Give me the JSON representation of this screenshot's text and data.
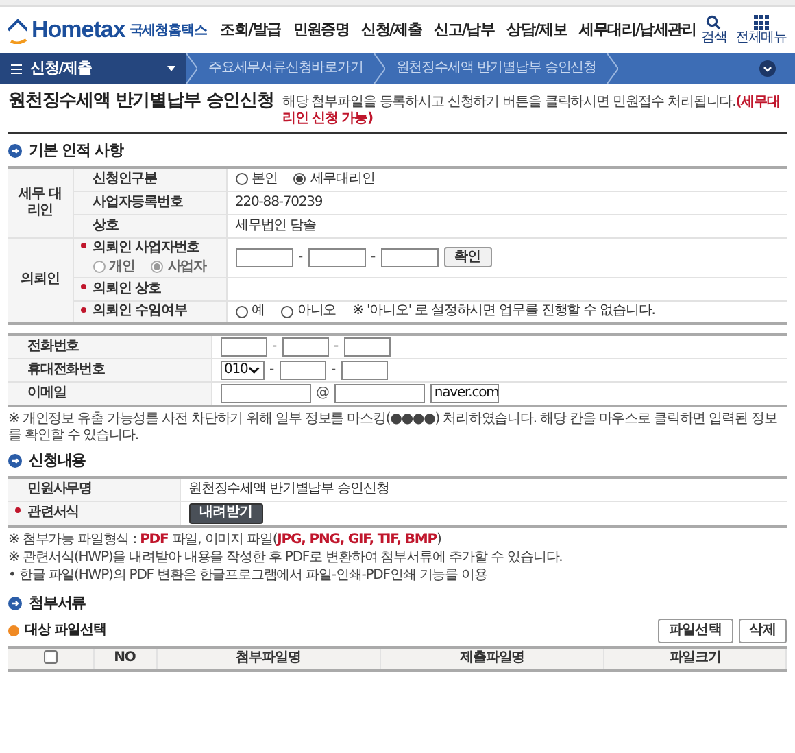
{
  "header": {
    "logo": {
      "brand": "Hometax",
      "name": "국세청홈택스"
    },
    "nav": [
      "조회/발급",
      "민원증명",
      "신청/제출",
      "신고/납부",
      "상담/제보",
      "세무대리/납세관리"
    ],
    "tools": [
      {
        "kind": "search",
        "label": "검색"
      },
      {
        "kind": "menu",
        "label": "전체메뉴"
      }
    ]
  },
  "breadcrumb": {
    "menu": "신청/제출",
    "items": [
      "주요세무서류신청바로가기",
      "원천징수세액 반기별납부 승인신청"
    ]
  },
  "page": {
    "title": "원천징수세액 반기별납부 승인신청",
    "description": "해당 첨부파일을 등록하시고 신청하기 버튼을 클릭하시면 민원접수 처리됩니다.**(세무대리인 신청 가능)**"
  },
  "basic_info": {
    "heading": "기본 인적 사항",
    "groups": [
      {
        "label": "세무 대리인",
        "rows": [
          {
            "label": "신청인구분",
            "kind": "radios",
            "options": [
              {
                "label": "본인",
                "selected": false
              },
              {
                "label": "세무대리인",
                "selected": true
              }
            ]
          },
          {
            "label": "사업자등록번호",
            "kind": "text",
            "value": "220-88-70239"
          },
          {
            "label": "상호",
            "kind": "text",
            "value": "세무법인 담솔"
          }
        ]
      },
      {
        "label": "의뢰인",
        "rows": [
          {
            "label": "의뢰인 사업자번호",
            "required": true,
            "kind": "bizno",
            "separator": "-",
            "button": "확인",
            "sub_options": [
              {
                "label": "개인",
                "selected": false,
                "disabled": true
              },
              {
                "label": "사업자",
                "selected": true,
                "disabled": true
              }
            ]
          },
          {
            "label": "의뢰인 상호",
            "required": true,
            "kind": "text"
          },
          {
            "label": "의뢰인 수임여부",
            "required": true,
            "kind": "radios",
            "options": [
              {
                "label": "예",
                "selected": false
              },
              {
                "label": "아니오",
                "selected": false
              }
            ],
            "note": "※ '아니오' 로 설정하시면 업무를 진행할 수 없습니다."
          }
        ]
      }
    ]
  },
  "contact": {
    "rows": [
      {
        "label": "전화번호",
        "kind": "phone",
        "separator": "-"
      },
      {
        "label": "휴대전화번호",
        "kind": "mobile",
        "separator": "-",
        "prefix": "010"
      },
      {
        "label": "이메일",
        "kind": "email",
        "at": "@",
        "domain": "naver.com"
      }
    ],
    "note": "※ 개인정보 유출 가능성를 사전 차단하기 위해 일부 정보를 마스킹(●●●●) 처리하였습니다. 해당 칸을 마우스로 클릭하면 입력된 정보를 확인할 수 있습니다."
  },
  "application": {
    "heading": "신청내용",
    "rows": [
      {
        "label": "민원사무명",
        "kind": "text",
        "value": "원천징수세액 반기별납부 승인신청"
      },
      {
        "label": "관련서식",
        "required": true,
        "kind": "button",
        "button": "내려받기"
      }
    ],
    "notes": [
      "※ 첨부가능 파일형식 : **PDF** 파일, 이미지 파일(**JPG, PNG, GIF, TIF, BMP**)",
      "※ 관련서식(HWP)을 내려받아 내용을 작성한 후 PDF로 변환하여 첨부서류에 추가할 수 있습니다.",
      "• 한글 파일(HWP)의 PDF 변환은 한글프로그램에서 파일-인쇄-PDF인쇄 기능를 이용"
    ]
  },
  "attachments": {
    "heading": "첨부서류",
    "subheading": "대상 파일선택",
    "buttons": [
      "파일선택",
      "삭제"
    ],
    "select_all": false,
    "columns": [
      "NO",
      "첨부파일명",
      "제출파일명",
      "파일크기"
    ]
  }
}
